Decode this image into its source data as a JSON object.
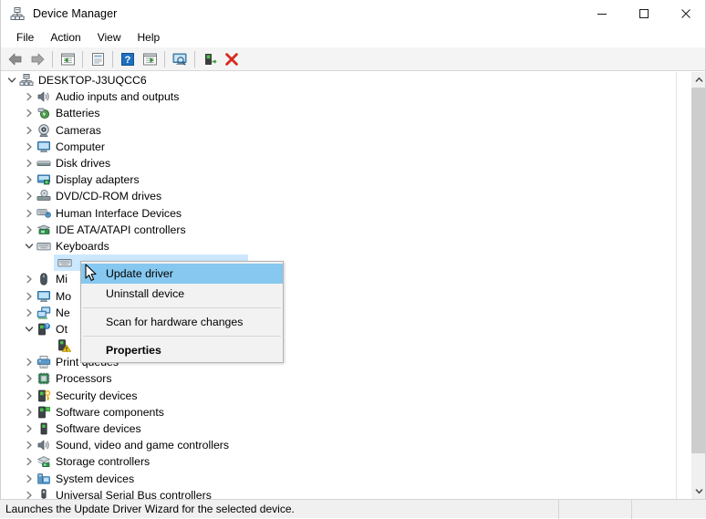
{
  "window": {
    "title": "Device Manager",
    "icon": "device-manager-icon",
    "controls": [
      {
        "name": "minimize-button",
        "glyph": "minimize"
      },
      {
        "name": "maximize-button",
        "glyph": "maximize"
      },
      {
        "name": "close-button",
        "glyph": "close"
      }
    ]
  },
  "menubar": {
    "items": [
      {
        "label": "File"
      },
      {
        "label": "Action"
      },
      {
        "label": "View"
      },
      {
        "label": "Help"
      }
    ]
  },
  "toolbar": {
    "buttons": [
      {
        "name": "back-button",
        "icon": "back-arrow-icon"
      },
      {
        "name": "forward-button",
        "icon": "forward-arrow-icon"
      },
      {
        "name": "separator-1",
        "icon": "separator"
      },
      {
        "name": "show-hide-console-tree-button",
        "icon": "console-tree-icon"
      },
      {
        "name": "separator-2",
        "icon": "separator"
      },
      {
        "name": "properties-button",
        "icon": "properties-icon"
      },
      {
        "name": "separator-3",
        "icon": "separator"
      },
      {
        "name": "help-button",
        "icon": "help-question-icon"
      },
      {
        "name": "show-hide-action-pane-button",
        "icon": "action-pane-icon"
      },
      {
        "name": "separator-4",
        "icon": "separator"
      },
      {
        "name": "scan-hardware-changes-button",
        "icon": "scan-monitor-icon"
      },
      {
        "name": "separator-5",
        "icon": "separator"
      },
      {
        "name": "update-driver-button",
        "icon": "update-driver-icon"
      },
      {
        "name": "uninstall-device-button",
        "icon": "red-x-icon"
      }
    ]
  },
  "tree": {
    "root": {
      "label": "DESKTOP-J3UQCC6",
      "icon": "computer-root-icon",
      "expanded": true
    },
    "items": [
      {
        "label": "Audio inputs and outputs",
        "icon": "speaker-icon",
        "expanded": false,
        "indent": 1
      },
      {
        "label": "Batteries",
        "icon": "battery-icon",
        "expanded": false,
        "indent": 1
      },
      {
        "label": "Cameras",
        "icon": "camera-icon",
        "expanded": false,
        "indent": 1
      },
      {
        "label": "Computer",
        "icon": "monitor-icon",
        "expanded": false,
        "indent": 1
      },
      {
        "label": "Disk drives",
        "icon": "disk-drive-icon",
        "expanded": false,
        "indent": 1
      },
      {
        "label": "Display adapters",
        "icon": "display-adapter-icon",
        "expanded": false,
        "indent": 1
      },
      {
        "label": "DVD/CD-ROM drives",
        "icon": "dvd-drive-icon",
        "expanded": false,
        "indent": 1
      },
      {
        "label": "Human Interface Devices",
        "icon": "hid-icon",
        "expanded": false,
        "indent": 1
      },
      {
        "label": "IDE ATA/ATAPI controllers",
        "icon": "ide-controller-icon",
        "expanded": false,
        "indent": 1
      },
      {
        "label": "Keyboards",
        "icon": "keyboard-icon",
        "expanded": true,
        "indent": 1
      },
      {
        "label": "",
        "icon": "keyboard-device-icon",
        "expanded": null,
        "indent": 2,
        "selected": true
      },
      {
        "label": "Mi",
        "icon": "mouse-icon",
        "expanded": false,
        "indent": 1,
        "occluded": true
      },
      {
        "label": "Mo",
        "icon": "monitor-icon",
        "expanded": false,
        "indent": 1,
        "occluded": true
      },
      {
        "label": "Ne",
        "icon": "network-adapter-icon",
        "expanded": false,
        "indent": 1,
        "occluded": true
      },
      {
        "label": "Ot",
        "icon": "other-device-icon",
        "expanded": true,
        "indent": 1,
        "occluded": true
      },
      {
        "label": "",
        "icon": "unknown-device-warning-icon",
        "expanded": null,
        "indent": 2,
        "occluded": true
      },
      {
        "label": "Print queues",
        "icon": "printer-icon",
        "expanded": false,
        "indent": 1
      },
      {
        "label": "Processors",
        "icon": "processor-icon",
        "expanded": false,
        "indent": 1
      },
      {
        "label": "Security devices",
        "icon": "security-device-icon",
        "expanded": false,
        "indent": 1
      },
      {
        "label": "Software components",
        "icon": "software-component-icon",
        "expanded": false,
        "indent": 1
      },
      {
        "label": "Software devices",
        "icon": "software-device-icon",
        "expanded": false,
        "indent": 1
      },
      {
        "label": "Sound, video and game controllers",
        "icon": "speaker-icon",
        "expanded": false,
        "indent": 1
      },
      {
        "label": "Storage controllers",
        "icon": "storage-controller-icon",
        "expanded": false,
        "indent": 1
      },
      {
        "label": "System devices",
        "icon": "system-device-icon",
        "expanded": false,
        "indent": 1
      },
      {
        "label": "Universal Serial Bus controllers",
        "icon": "usb-controller-icon",
        "expanded": false,
        "indent": 1
      }
    ]
  },
  "context_menu": {
    "items": [
      {
        "label": "Update driver",
        "highlighted": true,
        "bold": false
      },
      {
        "label": "Uninstall device",
        "highlighted": false,
        "bold": false
      },
      {
        "separator": true
      },
      {
        "label": "Scan for hardware changes",
        "highlighted": false,
        "bold": false
      },
      {
        "separator": true
      },
      {
        "label": "Properties",
        "highlighted": false,
        "bold": true
      }
    ]
  },
  "statusbar": {
    "message": "Launches the Update Driver Wizard for the selected device."
  },
  "colors": {
    "selection_blue": "#cce8ff",
    "menu_highlight": "#86c8ef",
    "toolbar_bg": "#f4f4f4",
    "statusbar_bg": "#f0f0f0",
    "scrollbar_thumb": "#cdcdcd",
    "red_x": "#d52b1e"
  }
}
